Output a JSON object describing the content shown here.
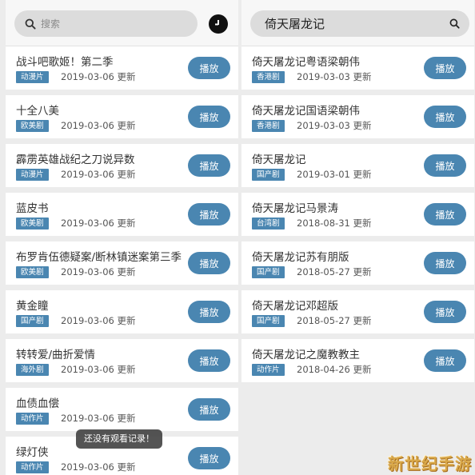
{
  "left": {
    "search": {
      "placeholder": "搜索"
    },
    "items": [
      {
        "title": "战斗吧歌姬！第二季",
        "tag": "动漫片",
        "date": "2019-03-06 更新",
        "play": "播放"
      },
      {
        "title": "十全八美",
        "tag": "欧美剧",
        "date": "2019-03-06 更新",
        "play": "播放"
      },
      {
        "title": "霹雳英雄战纪之刀说异数",
        "tag": "动漫片",
        "date": "2019-03-06 更新",
        "play": "播放"
      },
      {
        "title": "蓝皮书",
        "tag": "欧美剧",
        "date": "2019-03-06 更新",
        "play": "播放"
      },
      {
        "title": "布罗肯伍德疑案/断林镇迷案第三季",
        "tag": "欧美剧",
        "date": "2019-03-06 更新",
        "play": "播放"
      },
      {
        "title": "黄金瞳",
        "tag": "国产剧",
        "date": "2019-03-06 更新",
        "play": "播放"
      },
      {
        "title": "转转爱/曲折爱情",
        "tag": "海外剧",
        "date": "2019-03-06 更新",
        "play": "播放"
      },
      {
        "title": "血债血偿",
        "tag": "动作片",
        "date": "2019-03-06 更新",
        "play": "播放"
      },
      {
        "title": "绿灯侠",
        "tag": "动作片",
        "date": "2019-03-06 更新",
        "play": "播放"
      }
    ],
    "toast": "还没有观看记录！"
  },
  "right": {
    "search": {
      "query": "倚天屠龙记"
    },
    "items": [
      {
        "title": "倚天屠龙记粤语梁朝伟",
        "tag": "香港剧",
        "date": "2019-03-03 更新",
        "play": "播放"
      },
      {
        "title": "倚天屠龙记国语梁朝伟",
        "tag": "香港剧",
        "date": "2019-03-03 更新",
        "play": "播放"
      },
      {
        "title": "倚天屠龙记",
        "tag": "国产剧",
        "date": "2019-03-01 更新",
        "play": "播放"
      },
      {
        "title": "倚天屠龙记马景涛",
        "tag": "台湾剧",
        "date": "2018-08-31 更新",
        "play": "播放"
      },
      {
        "title": "倚天屠龙记苏有朋版",
        "tag": "国产剧",
        "date": "2018-05-27 更新",
        "play": "播放"
      },
      {
        "title": "倚天屠龙记邓超版",
        "tag": "国产剧",
        "date": "2018-05-27 更新",
        "play": "播放"
      },
      {
        "title": "倚天屠龙记之魔教教主",
        "tag": "动作片",
        "date": "2018-04-26 更新",
        "play": "播放"
      }
    ]
  },
  "watermark": "新世纪手游",
  "colors": {
    "accent": "#4a86b1",
    "background": "#ececec",
    "card": "#ffffff"
  },
  "icons": {
    "search": "search-icon",
    "history": "clock-icon"
  }
}
